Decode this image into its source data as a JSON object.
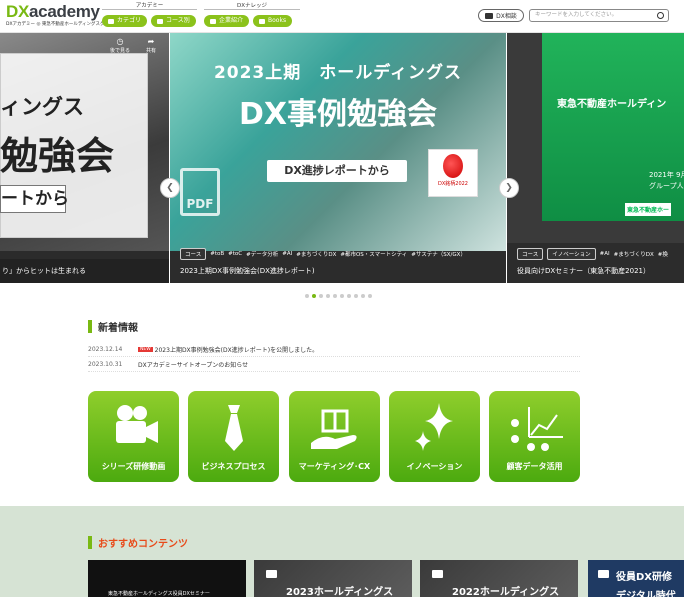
{
  "header": {
    "logo_brand_prefix": "DX",
    "logo_brand_suffix": "academy",
    "logo_sub": "DXアカデミー ◎ 東急不動産ホールディングスグループ",
    "academy_label": "アカデミー",
    "academy_buttons": [
      "カテゴリ",
      "コース別"
    ],
    "knowledge_label": "DXナレッジ",
    "knowledge_buttons": [
      "企業紹介",
      "Books"
    ],
    "consult_button": "DX相談",
    "search_placeholder": "キーワードを入力してください。"
  },
  "carousel": {
    "left_slide": {
      "text_line1": "ィングス",
      "text_line2": "勉強会",
      "from_box": "ートから",
      "caption": "り」からヒットは生まれる",
      "icon_labels": [
        "後で見る",
        "共有"
      ]
    },
    "main_slide": {
      "heading": "2023上期　ホールディングス",
      "big_title": "DX事例勉強会",
      "tag": "DX進捗レポートから",
      "pdf_label": "PDF",
      "award_label": "DX銘柄2022",
      "course_tag": "コース",
      "hashtags": [
        "#toB",
        "#toC",
        "#データ分析",
        "#AI",
        "#まちづくりDX",
        "#都市OS・スマートシティ",
        "#サステナ（SX/GX）"
      ],
      "caption": "2023上期DX事例勉強会(DX進捗レポート)"
    },
    "right_slide": {
      "heading": "東急不動産ホールディン",
      "date": "2021年 9月",
      "group": "グループ人",
      "logo": "東急不動産ホー",
      "tags": [
        "コース",
        "イノベーション"
      ],
      "hashtags": [
        "#AI",
        "#まちづくりDX",
        "#換"
      ],
      "caption": "役員向けDXセミナー（東急不動産2021）"
    },
    "dots_count": 10,
    "active_dot": 1
  },
  "news": {
    "heading": "新着情報",
    "items": [
      {
        "date": "2023.12.14",
        "badge": "NEW",
        "text": "2023上期DX事例勉強会(DX進捗レポート)を公開しました。"
      },
      {
        "date": "2023.10.31",
        "badge": "",
        "text": "DXアカデミーサイトオープンのお知らせ"
      }
    ]
  },
  "categories": [
    {
      "label": "シリーズ研修動画",
      "icon": "video-camera-icon"
    },
    {
      "label": "ビジネスプロセス",
      "icon": "necktie-icon"
    },
    {
      "label": "マーケティング･CX",
      "icon": "gift-hand-icon"
    },
    {
      "label": "イノベーション",
      "icon": "sparkle-icon"
    },
    {
      "label": "顧客データ活用",
      "icon": "data-chart-icon"
    }
  ],
  "recommended": {
    "heading": "おすすめコンテンツ",
    "cards": [
      {
        "text": "東急不動産ホールディングス役員DXセミナー"
      },
      {
        "text": "2023ホールディングス"
      },
      {
        "text": "2022ホールディングス"
      },
      {
        "text": "役員DX研修",
        "sub": "デジタル時代"
      }
    ]
  },
  "colors": {
    "brand_green": "#79b913",
    "accent_red": "#e84b1a"
  }
}
